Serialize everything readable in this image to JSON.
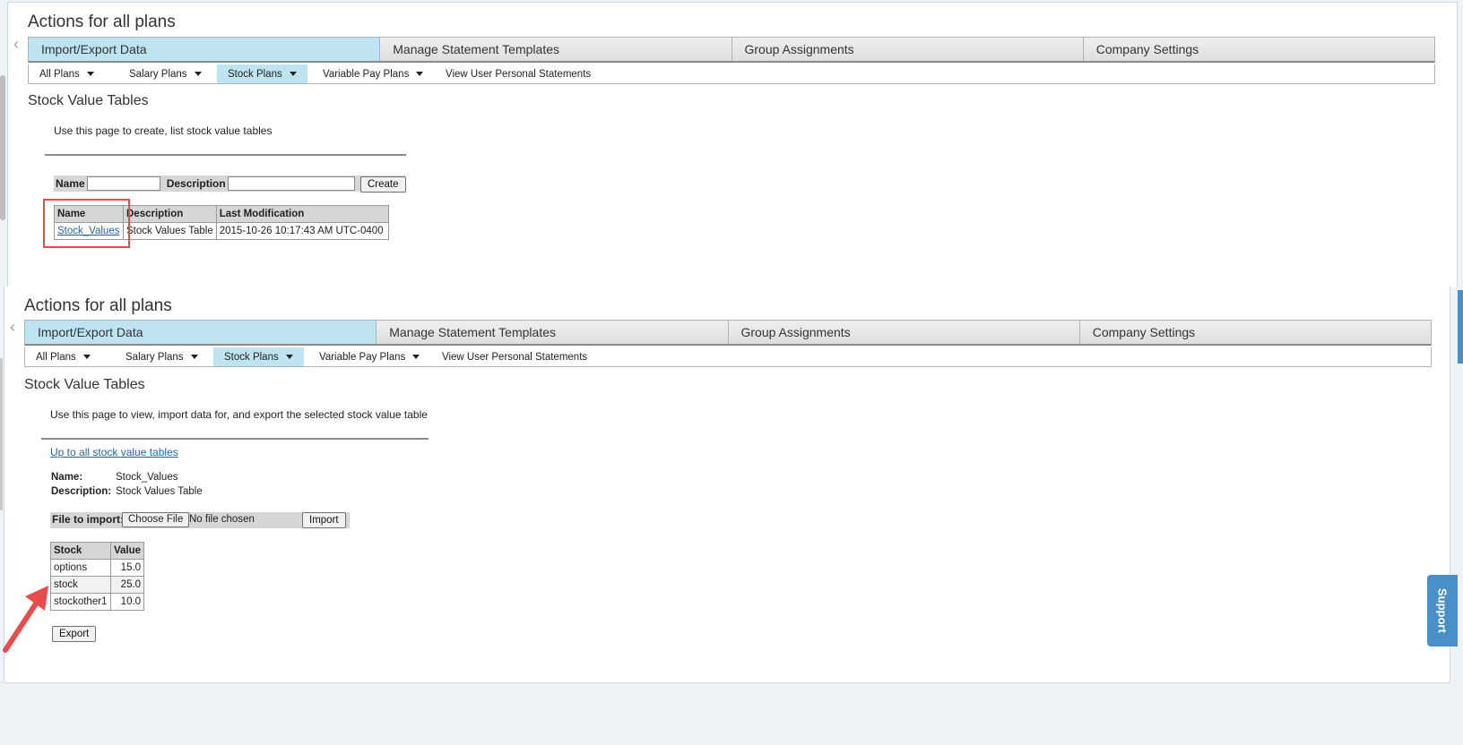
{
  "header": {
    "title": "Actions for all plans"
  },
  "main_tabs": [
    {
      "label": "Import/Export Data",
      "active": true
    },
    {
      "label": "Manage Statement Templates",
      "active": false
    },
    {
      "label": "Group Assignments",
      "active": false
    },
    {
      "label": "Company Settings",
      "active": false
    }
  ],
  "sub_tabs": [
    {
      "label": "All Plans",
      "has_caret": true,
      "active": false
    },
    {
      "label": "Salary Plans",
      "has_caret": true,
      "active": false
    },
    {
      "label": "Stock Plans",
      "has_caret": true,
      "active": true
    },
    {
      "label": "Variable Pay Plans",
      "has_caret": true,
      "active": false
    },
    {
      "label": "View User Personal Statements",
      "has_caret": false,
      "active": false
    }
  ],
  "list_page": {
    "section_title": "Stock Value Tables",
    "description": "Use this page to create, list stock value tables",
    "form": {
      "name_label": "Name",
      "name_value": "",
      "description_label": "Description",
      "description_value": "",
      "create_label": "Create"
    },
    "table": {
      "headers": [
        "Name",
        "Description",
        "Last Modification"
      ],
      "rows": [
        {
          "name": "Stock_Values",
          "description": "Stock Values Table",
          "modified": "2015-10-26 10:17:43 AM UTC-0400"
        }
      ]
    }
  },
  "detail_page": {
    "section_title": "Stock Value Tables",
    "description": "Use this page to view, import data for, and export the selected stock value table",
    "back_link": "Up to all stock value tables",
    "name_label": "Name:",
    "name_value": "Stock_Values",
    "desc_label": "Description:",
    "desc_value": "Stock Values Table",
    "file_label": "File to import:",
    "choose_file_label": "Choose File",
    "no_file_text": "No file chosen",
    "import_label": "Import",
    "table": {
      "headers": [
        "Stock",
        "Value"
      ],
      "rows": [
        {
          "stock": "options",
          "value": "15.0"
        },
        {
          "stock": "stock",
          "value": "25.0"
        },
        {
          "stock": "stockother1",
          "value": "10.0"
        }
      ]
    },
    "export_label": "Export"
  },
  "support": {
    "label": "Support"
  },
  "colors": {
    "active_tab": "#bde4f0",
    "annotation_red": "#e84c4c",
    "support_blue": "#4a90c8",
    "link": "#2a6496"
  },
  "icons": {
    "back": "chevron-left-icon",
    "dropdown": "caret-down-icon"
  }
}
